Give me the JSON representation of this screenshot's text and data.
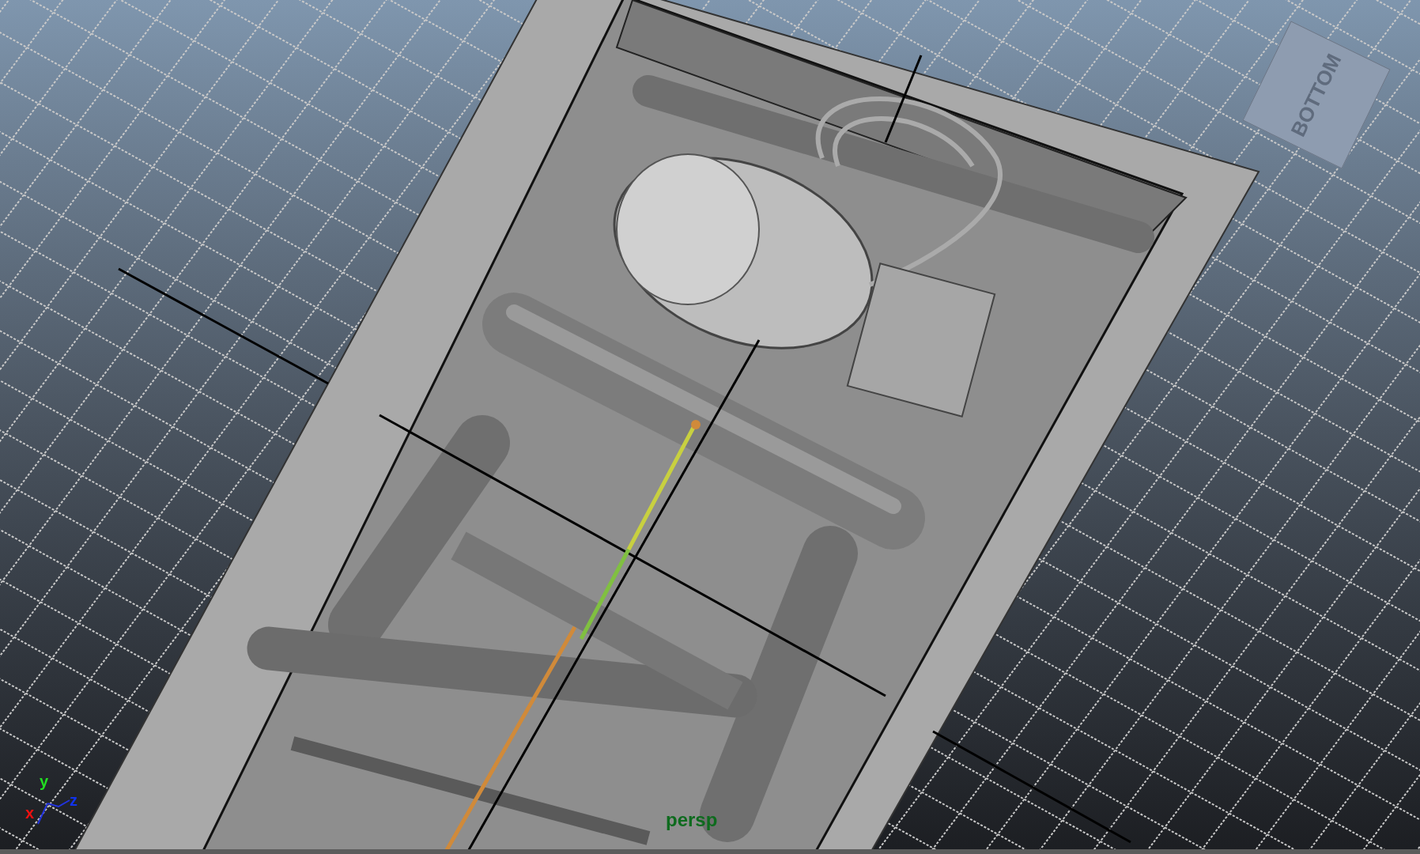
{
  "viewport": {
    "view_cube_label": "BOTTOM",
    "camera_label": "persp",
    "axis_labels": [
      {
        "text": "y",
        "color": "#22dd22"
      },
      {
        "text": "x",
        "color": "#ee1111"
      },
      {
        "text": "z",
        "color": "#1133ee"
      }
    ]
  }
}
